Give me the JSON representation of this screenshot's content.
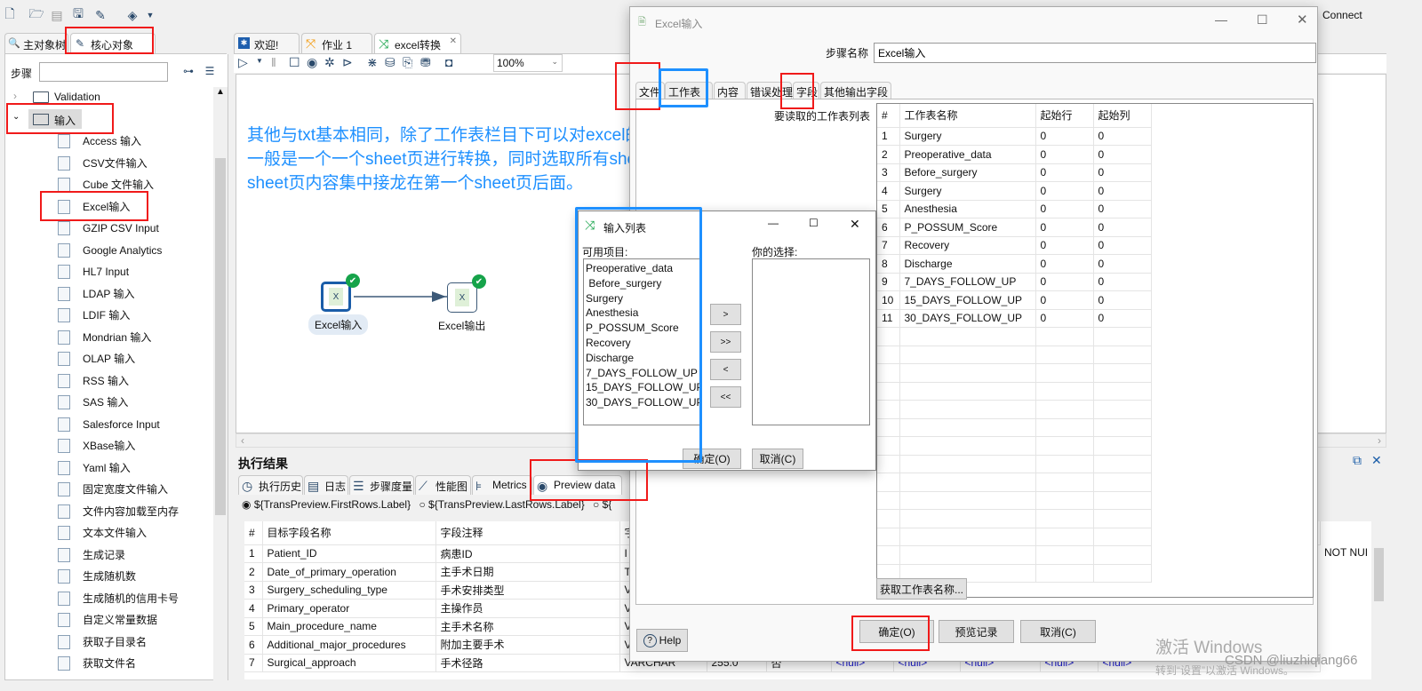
{
  "toolbar": {
    "icons": [
      "new-file-icon",
      "open-folder-icon",
      "explore-repository-icon",
      "save-icon",
      "save-as-icon",
      "layers-icon"
    ],
    "connect_label": "Connect"
  },
  "left_panel": {
    "tabs": [
      {
        "label": "主对象树"
      },
      {
        "label": "核心对象"
      }
    ],
    "search_label": "步骤",
    "search_value": "",
    "tree": {
      "folders": [
        {
          "label": "Validation",
          "expanded": false
        },
        {
          "label": "输入",
          "expanded": true
        }
      ],
      "items": [
        "Access 输入",
        "CSV文件输入",
        "Cube 文件输入",
        "Excel输入",
        "GZIP CSV Input",
        "Google Analytics",
        "HL7 Input",
        "LDAP 输入",
        "LDIF 输入",
        "Mondrian 输入",
        "OLAP 输入",
        "RSS 输入",
        "SAS 输入",
        "Salesforce Input",
        "XBase输入",
        "Yaml 输入",
        "固定宽度文件输入",
        "文件内容加载至内存",
        "文本文件输入",
        "生成记录",
        "生成随机数",
        "生成随机的信用卡号",
        "自定义常量数据",
        "获取子目录名",
        "获取文件名"
      ]
    }
  },
  "editor": {
    "tabs": [
      {
        "label": "欢迎!"
      },
      {
        "label": "作业 1"
      },
      {
        "label": "excel转换"
      }
    ],
    "zoom": "100%",
    "annotation": [
      "其他与txt基本相同，除了工作表栏目下可以对excel的sheet业进行选择，",
      "一般是一个一个sheet页进行转换，同时选取所有sheet页的话，则所有",
      "sheet页内容集中接龙在第一个sheet页后面。"
    ],
    "nodes": [
      {
        "label": "Excel输入"
      },
      {
        "label": "Excel输出"
      }
    ]
  },
  "results": {
    "title": "执行结果",
    "tabs": [
      "执行历史",
      "日志",
      "步骤度量",
      "性能图",
      "Metrics",
      "Preview data"
    ],
    "radios": [
      {
        "label": "${TransPreview.FirstRows.Label}",
        "checked": true
      },
      {
        "label": "${TransPreview.LastRows.Label}",
        "checked": false
      },
      {
        "label": "${",
        "checked": false
      }
    ],
    "columns": [
      "#",
      "目标字段名称",
      "字段注释",
      "字"
    ],
    "rows": [
      [
        "1",
        "Patient_ID",
        "病患ID",
        "I"
      ],
      [
        "2",
        "Date_of_primary_operation",
        "主手术日期",
        "T"
      ],
      [
        "3",
        "Surgery_scheduling_type",
        "手术安排类型",
        "V"
      ],
      [
        "4",
        "Primary_operator",
        "主操作员",
        "V"
      ],
      [
        "5",
        "Main_procedure_name",
        "主手术名称",
        "V"
      ],
      [
        "6",
        "Additional_major_procedures",
        "附加主要手术",
        "V"
      ],
      [
        "7",
        "Surgical_approach",
        "手术径路",
        "VARCHAR",
        "255.0",
        "否",
        "<null>",
        "<null>",
        "<null>",
        "<null>",
        "<null>"
      ]
    ],
    "right_text": "NOT NUI"
  },
  "excel_dialog": {
    "title": "Excel输入",
    "step_name_label": "步骤名称",
    "step_name_value": "Excel输入",
    "tabs": [
      "文件",
      "工作表",
      "内容",
      "错误处理",
      "字段",
      "其他输出字段"
    ],
    "active_tab": "工作表",
    "sheet_list_label": "要读取的工作表列表",
    "columns": [
      "#",
      "工作表名称",
      "起始行",
      "起始列"
    ],
    "rows": [
      [
        "1",
        "Surgery",
        "0",
        "0"
      ],
      [
        "2",
        "Preoperative_data",
        "0",
        "0"
      ],
      [
        "3",
        " Before_surgery",
        "0",
        "0"
      ],
      [
        "4",
        "Surgery",
        "0",
        "0"
      ],
      [
        "5",
        "Anesthesia",
        "0",
        "0"
      ],
      [
        "6",
        "P_POSSUM_Score",
        "0",
        "0"
      ],
      [
        "7",
        "Recovery",
        "0",
        "0"
      ],
      [
        "8",
        "Discharge",
        "0",
        "0"
      ],
      [
        "9",
        "7_DAYS_FOLLOW_UP",
        "0",
        "0"
      ],
      [
        "10",
        "15_DAYS_FOLLOW_UP",
        "0",
        "0"
      ],
      [
        "11",
        "30_DAYS_FOLLOW_UP",
        "0",
        "0"
      ]
    ],
    "get_sheets_button": "获取工作表名称...",
    "help_button": "Help",
    "ok_button": "确定(O)",
    "preview_button": "预览记录",
    "cancel_button": "取消(C)"
  },
  "list_dialog": {
    "title": "输入列表",
    "available_label": "可用项目:",
    "available": [
      "Preoperative_data",
      " Before_surgery",
      "Surgery",
      "Anesthesia",
      "P_POSSUM_Score",
      "Recovery",
      "Discharge",
      "7_DAYS_FOLLOW_UP",
      "15_DAYS_FOLLOW_UP",
      "30_DAYS_FOLLOW_UP"
    ],
    "selected_label": "你的选择:",
    "move_buttons": [
      ">",
      ">>",
      "<",
      "<<"
    ],
    "ok_button": "确定(O)",
    "cancel_button": "取消(C)"
  },
  "watermark": {
    "line1": "激活 Windows",
    "line2": "转到“设置”以激活 Windows。",
    "credit": "CSDN @liuzhiqiang66"
  },
  "colors": {
    "annotation_red": "#f01a1a",
    "annotation_blue": "#1e90ff",
    "annotation_text": "#1e90ff",
    "null_text": "#1a1ad0",
    "ok_check": "#16a34a"
  }
}
